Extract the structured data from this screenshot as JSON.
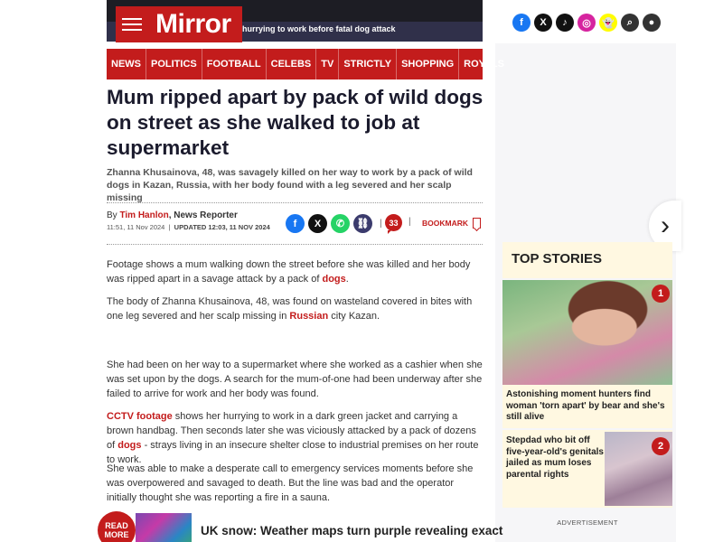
{
  "header": {
    "logo": "Mirror",
    "ticker": "hurrying to work before fatal dog attack",
    "socials": [
      {
        "icon": "facebook-icon",
        "glyph": "f",
        "color": "#1877f2"
      },
      {
        "icon": "x-icon",
        "glyph": "X",
        "color": "#111111"
      },
      {
        "icon": "tiktok-icon",
        "glyph": "♪",
        "color": "#111111"
      },
      {
        "icon": "instagram-icon",
        "glyph": "◎",
        "color": "#d6249f"
      },
      {
        "icon": "snapchat-icon",
        "glyph": "👻",
        "color": "#fffc00"
      },
      {
        "icon": "search-icon",
        "glyph": "⌕",
        "color": "#333333"
      },
      {
        "icon": "account-icon",
        "glyph": "●",
        "color": "#333333"
      }
    ]
  },
  "nav": [
    "NEWS",
    "POLITICS",
    "FOOTBALL",
    "CELEBS",
    "TV",
    "STRICTLY",
    "SHOPPING",
    "ROYALS"
  ],
  "article": {
    "headline": "Mum ripped apart by pack of wild dogs on street as she walked to job at supermarket",
    "standfirst": "Zhanna Khusainova, 48, was savagely killed on her way to work by a pack of wild dogs in Kazan, Russia, with her body found with a leg severed and her scalp missing",
    "by": "By",
    "author": "Tim Hanlon",
    "role": ", News Reporter",
    "published": "11:51, 11 Nov 2024",
    "updated": "UPDATED 12:03, 11 NOV 2024",
    "comment_count": "33",
    "bookmark": "BOOKMARK",
    "p1_a": "Footage shows a mum walking down the street before she was killed and her body was ripped apart in a savage attack by a pack of ",
    "p1_link": "dogs",
    "p1_b": ".",
    "p2_a": "The body of Zhanna Khusainova, 48, was found on wasteland covered in bites with one leg severed and her scalp missing in ",
    "p2_link": "Russian",
    "p2_b": " city Kazan.",
    "p3": "She had been on her way to a supermarket where she worked as a cashier when she was set upon by the dogs. A search for the mum-of-one had been underway after she failed to arrive for work and her body was found.",
    "p4_link1": "CCTV footage",
    "p4_a": " shows her hurrying to work in a dark green jacket and carrying a brown handbag. Then seconds later she was viciously attacked by a pack of dozens of ",
    "p4_link2": "dogs",
    "p4_b": " - strays living in an insecure shelter close to industrial premises on her route to work.",
    "p5": "She was able to make a desperate call to emergency services moments before she was overpowered and savaged to death. But the line was bad and the operator initially thought she was reporting a fire in a sauna."
  },
  "read_more": {
    "label_line1": "READ",
    "label_line2": "MORE",
    "title": "UK snow: Weather maps turn purple revealing exact"
  },
  "sidebar": {
    "title": "TOP STORIES",
    "stories": [
      {
        "rank": "1",
        "title": "Astonishing moment hunters find woman 'torn apart' by bear and she's still alive"
      },
      {
        "rank": "2",
        "title": "Stepdad who bit off five-year-old's genitals jailed as mum loses parental rights"
      }
    ],
    "advertisement": "ADVERTISEMENT"
  },
  "colors": {
    "brand": "#c31c1c"
  }
}
